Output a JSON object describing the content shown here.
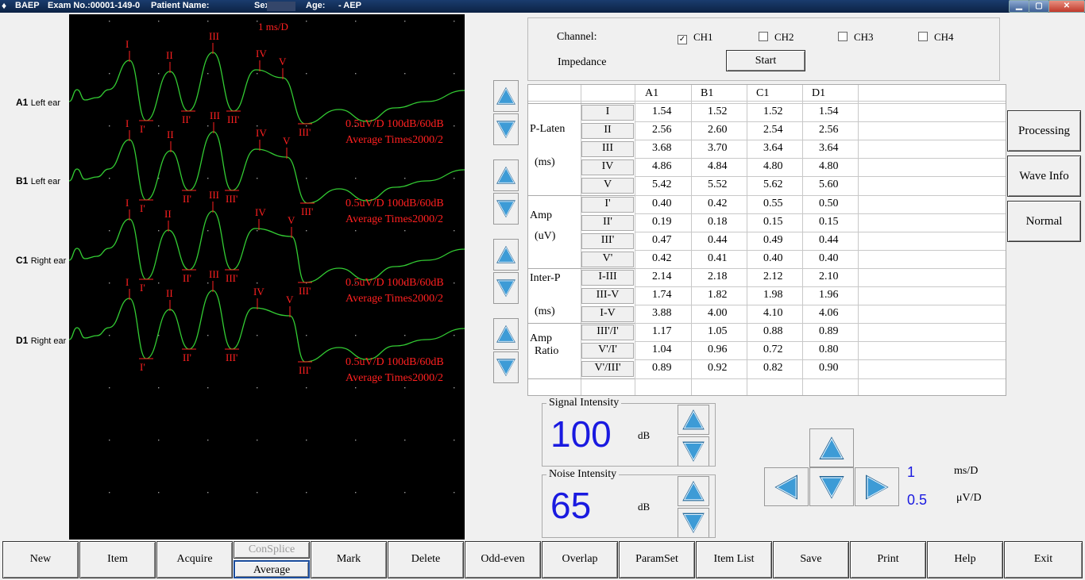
{
  "titlebar": {
    "app": "BAEP",
    "exam": "Exam No.:00001-149-0",
    "patient": "Patient Name:",
    "sex": "Sex:",
    "age": "Age:",
    "mode": "- AEP"
  },
  "channels_left": [
    {
      "name": "A1",
      "ear": "Left ear"
    },
    {
      "name": "B1",
      "ear": "Left ear"
    },
    {
      "name": "C1",
      "ear": "Right ear"
    },
    {
      "name": "D1",
      "ear": "Right ear"
    }
  ],
  "wave": {
    "timescale": "1 ms/D",
    "info1": "0.5uV/D  100dB/60dB",
    "info2": "Average Times2000/2",
    "trace_color": "#33cc33",
    "marker_color": "#ff2020",
    "peak_labels": [
      "I",
      "II",
      "III",
      "IV",
      "V"
    ],
    "trough_labels": [
      "I'",
      "II'",
      "III'",
      "III'",
      "V'"
    ]
  },
  "channel_select": {
    "label": "Channel:",
    "impedance": "Impedance",
    "start": "Start",
    "options": [
      {
        "label": "CH1",
        "checked": true,
        "mark": "✓"
      },
      {
        "label": "CH2",
        "checked": false,
        "mark": ""
      },
      {
        "label": "CH3",
        "checked": false,
        "mark": ""
      },
      {
        "label": "CH4",
        "checked": false,
        "mark": ""
      }
    ]
  },
  "table": {
    "columns": [
      "A1",
      "B1",
      "C1",
      "D1"
    ],
    "groups": [
      {
        "label": "P-Laten",
        "unit": "(ms)"
      },
      {
        "label": "Amp",
        "unit": "(uV)"
      },
      {
        "label": "Inter-P",
        "unit": "(ms)"
      },
      {
        "label": "Amp",
        "unit": "Ratio"
      }
    ],
    "rows": [
      {
        "label": "I",
        "values": [
          "1.54",
          "1.52",
          "1.52",
          "1.54"
        ]
      },
      {
        "label": "II",
        "values": [
          "2.56",
          "2.60",
          "2.54",
          "2.56"
        ]
      },
      {
        "label": "III",
        "values": [
          "3.68",
          "3.70",
          "3.64",
          "3.64"
        ]
      },
      {
        "label": "IV",
        "values": [
          "4.86",
          "4.84",
          "4.80",
          "4.80"
        ]
      },
      {
        "label": "V",
        "values": [
          "5.42",
          "5.52",
          "5.62",
          "5.60"
        ]
      },
      {
        "label": "I'",
        "values": [
          "0.40",
          "0.42",
          "0.55",
          "0.50"
        ]
      },
      {
        "label": "II'",
        "values": [
          "0.19",
          "0.18",
          "0.15",
          "0.15"
        ]
      },
      {
        "label": "III'",
        "values": [
          "0.47",
          "0.44",
          "0.49",
          "0.44"
        ]
      },
      {
        "label": "V'",
        "values": [
          "0.42",
          "0.41",
          "0.40",
          "0.40"
        ]
      },
      {
        "label": "I-III",
        "values": [
          "2.14",
          "2.18",
          "2.12",
          "2.10"
        ]
      },
      {
        "label": "III-V",
        "values": [
          "1.74",
          "1.82",
          "1.98",
          "1.96"
        ]
      },
      {
        "label": "I-V",
        "values": [
          "3.88",
          "4.00",
          "4.10",
          "4.06"
        ]
      },
      {
        "label": "III'/I'",
        "values": [
          "1.17",
          "1.05",
          "0.88",
          "0.89"
        ]
      },
      {
        "label": "V'/I'",
        "values": [
          "1.04",
          "0.96",
          "0.72",
          "0.80"
        ]
      },
      {
        "label": "V'/III'",
        "values": [
          "0.89",
          "0.92",
          "0.82",
          "0.90"
        ]
      }
    ]
  },
  "side_buttons": {
    "processing": "Processing",
    "wave_info": "Wave Info",
    "normal": "Normal"
  },
  "signal": {
    "title": "Signal Intensity",
    "value": "100",
    "unit": "dB"
  },
  "noise": {
    "title": "Noise Intensity",
    "value": "65",
    "unit": "dB"
  },
  "scale": {
    "time_value": "1",
    "time_unit": "ms/D",
    "amp_value": "0.5",
    "amp_unit": "μV/D"
  },
  "toolbar": {
    "new": "New",
    "item": "Item",
    "acquire": "Acquire",
    "consplice": "ConSplice",
    "average": "Average",
    "mark": "Mark",
    "delete": "Delete",
    "oddeven": "Odd-even",
    "overlap": "Overlap",
    "paramset": "ParamSet",
    "itemlist": "Item List",
    "save": "Save",
    "print": "Print",
    "help": "Help",
    "exit": "Exit"
  }
}
